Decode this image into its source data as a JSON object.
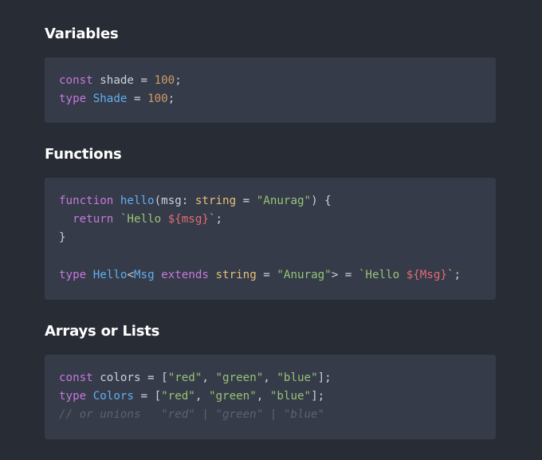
{
  "sections": [
    {
      "title": "Variables",
      "lines": [
        [
          {
            "text": "const",
            "kind": "kw"
          },
          {
            "text": " shade = ",
            "kind": "pl"
          },
          {
            "text": "100",
            "kind": "num"
          },
          {
            "text": ";",
            "kind": "pl"
          }
        ],
        [
          {
            "text": "type",
            "kind": "kw"
          },
          {
            "text": " ",
            "kind": "pl"
          },
          {
            "text": "Shade",
            "kind": "fn"
          },
          {
            "text": " = ",
            "kind": "pl"
          },
          {
            "text": "100",
            "kind": "num"
          },
          {
            "text": ";",
            "kind": "pl"
          }
        ]
      ]
    },
    {
      "title": "Functions",
      "lines": [
        [
          {
            "text": "function",
            "kind": "kw"
          },
          {
            "text": " ",
            "kind": "pl"
          },
          {
            "text": "hello",
            "kind": "fn"
          },
          {
            "text": "(msg: ",
            "kind": "pl"
          },
          {
            "text": "string",
            "kind": "ty"
          },
          {
            "text": " = ",
            "kind": "pl"
          },
          {
            "text": "\"Anurag\"",
            "kind": "str"
          },
          {
            "text": ") {",
            "kind": "pl"
          }
        ],
        [
          {
            "text": "  ",
            "kind": "pl"
          },
          {
            "text": "return",
            "kind": "kw"
          },
          {
            "text": " ",
            "kind": "pl"
          },
          {
            "text": "`Hello ",
            "kind": "str"
          },
          {
            "text": "${msg}",
            "kind": "tpl"
          },
          {
            "text": "`",
            "kind": "str"
          },
          {
            "text": ";",
            "kind": "pl"
          }
        ],
        [
          {
            "text": "}",
            "kind": "pl"
          }
        ],
        [],
        [
          {
            "text": "type",
            "kind": "kw"
          },
          {
            "text": " ",
            "kind": "pl"
          },
          {
            "text": "Hello",
            "kind": "fn"
          },
          {
            "text": "<",
            "kind": "pl"
          },
          {
            "text": "Msg",
            "kind": "fn"
          },
          {
            "text": " ",
            "kind": "pl"
          },
          {
            "text": "extends",
            "kind": "kw"
          },
          {
            "text": " ",
            "kind": "pl"
          },
          {
            "text": "string",
            "kind": "ty"
          },
          {
            "text": " = ",
            "kind": "pl"
          },
          {
            "text": "\"Anurag\"",
            "kind": "str"
          },
          {
            "text": "> = ",
            "kind": "pl"
          },
          {
            "text": "`Hello ",
            "kind": "str"
          },
          {
            "text": "${Msg}",
            "kind": "tpl"
          },
          {
            "text": "`",
            "kind": "str"
          },
          {
            "text": ";",
            "kind": "pl"
          }
        ]
      ]
    },
    {
      "title": "Arrays or Lists",
      "lines": [
        [
          {
            "text": "const",
            "kind": "kw"
          },
          {
            "text": " colors = [",
            "kind": "pl"
          },
          {
            "text": "\"red\"",
            "kind": "str"
          },
          {
            "text": ", ",
            "kind": "pl"
          },
          {
            "text": "\"green\"",
            "kind": "str"
          },
          {
            "text": ", ",
            "kind": "pl"
          },
          {
            "text": "\"blue\"",
            "kind": "str"
          },
          {
            "text": "];",
            "kind": "pl"
          }
        ],
        [
          {
            "text": "type",
            "kind": "kw"
          },
          {
            "text": " ",
            "kind": "pl"
          },
          {
            "text": "Colors",
            "kind": "fn"
          },
          {
            "text": " = [",
            "kind": "pl"
          },
          {
            "text": "\"red\"",
            "kind": "str"
          },
          {
            "text": ", ",
            "kind": "pl"
          },
          {
            "text": "\"green\"",
            "kind": "str"
          },
          {
            "text": ", ",
            "kind": "pl"
          },
          {
            "text": "\"blue\"",
            "kind": "str"
          },
          {
            "text": "];",
            "kind": "pl"
          }
        ],
        [
          {
            "text": "// or unions   \"red\" | \"green\" | \"blue\"",
            "kind": "cm"
          }
        ]
      ]
    }
  ]
}
